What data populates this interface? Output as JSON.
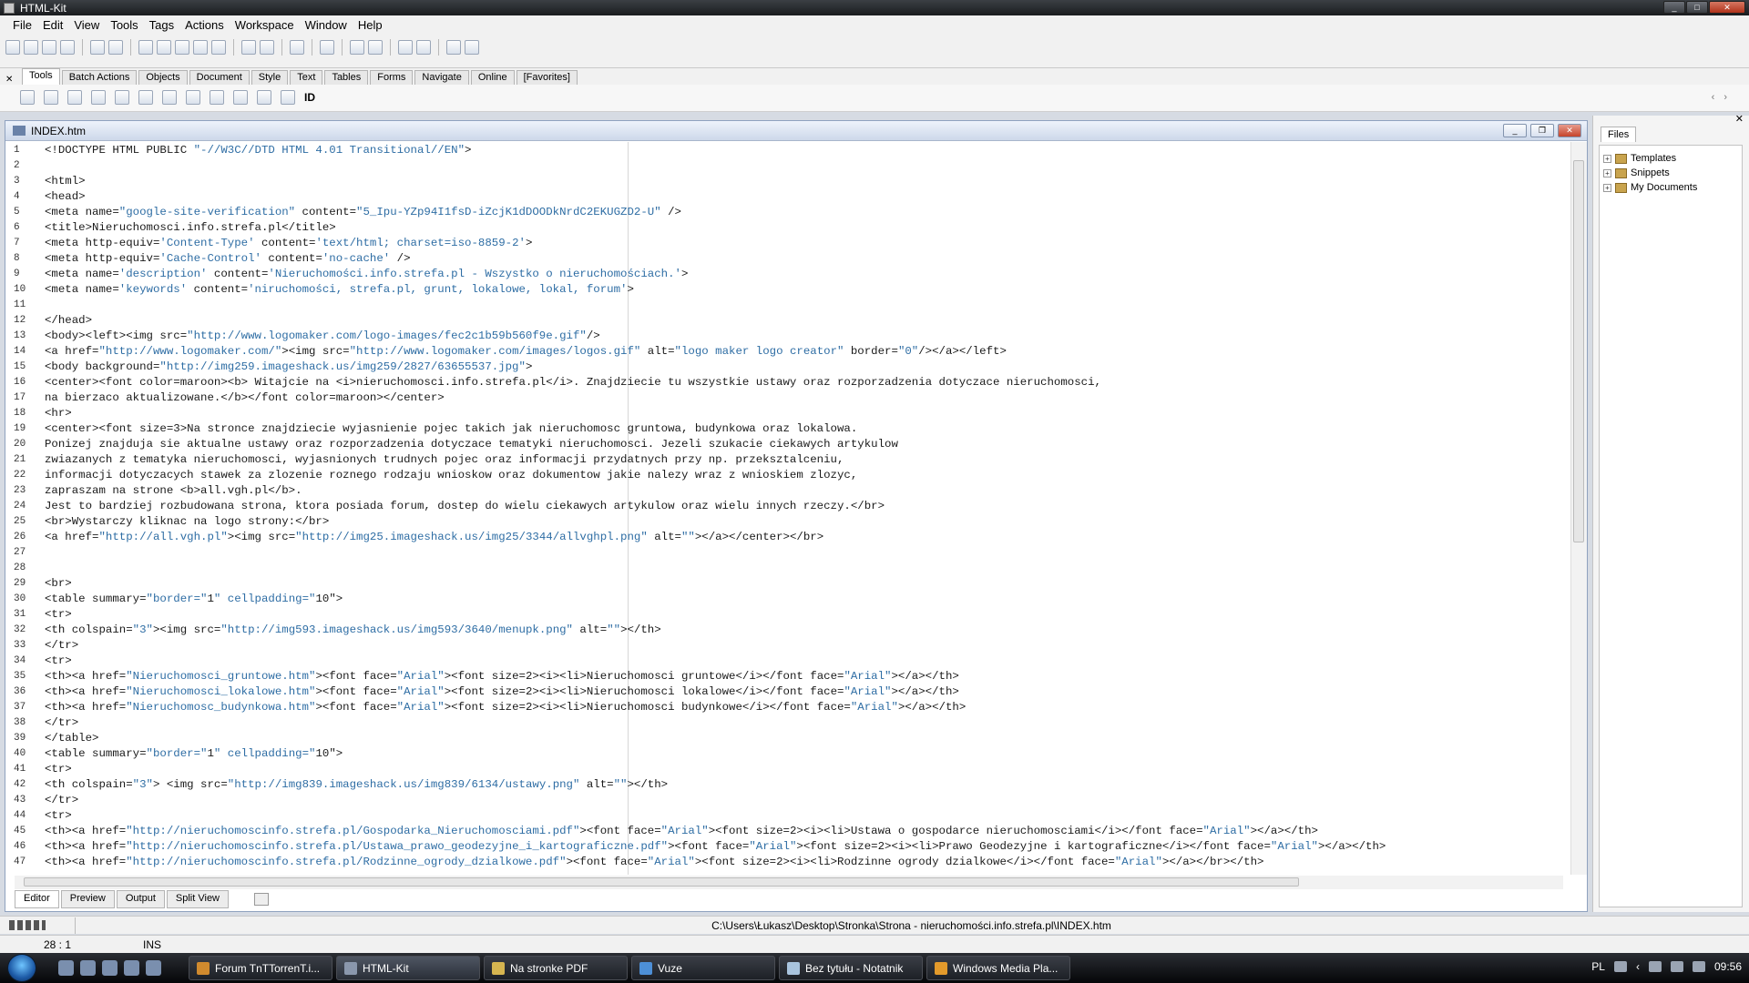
{
  "window": {
    "title": "HTML-Kit"
  },
  "menu": [
    "File",
    "Edit",
    "View",
    "Tools",
    "Tags",
    "Actions",
    "Workspace",
    "Window",
    "Help"
  ],
  "tabs": [
    "Tools",
    "Batch Actions",
    "Objects",
    "Document",
    "Style",
    "Text",
    "Tables",
    "Forms",
    "Navigate",
    "Online",
    "[Favorites]"
  ],
  "tools_row_label": "ID",
  "editor": {
    "title": "INDEX.htm",
    "lines": [
      "<!DOCTYPE HTML PUBLIC \"-//W3C//DTD HTML 4.01 Transitional//EN\">",
      "",
      "<html>",
      "<head>",
      "<meta name=\"google-site-verification\" content=\"5_Ipu-YZp94I1fsD-iZcjK1dDOODkNrdC2EKUGZD2-U\" />",
      "<title>Nieruchomosci.info.strefa.pl</title>",
      "<meta http-equiv='Content-Type' content='text/html; charset=iso-8859-2'>",
      "<meta http-equiv='Cache-Control' content='no-cache' />",
      "<meta name='description' content='Nieruchomości.info.strefa.pl - Wszystko o nieruchomościach.'>",
      "<meta name='keywords' content='niruchomości, strefa.pl, grunt, lokalowe, lokal, forum'>",
      "",
      "</head>",
      "<body><left><img src=\"http://www.logomaker.com/logo-images/fec2c1b59b560f9e.gif\"/>",
      "<a href=\"http://www.logomaker.com/\"><img src=\"http://www.logomaker.com/images/logos.gif\" alt=\"logo maker logo creator\" border=\"0\"/></a></left>",
      "<body background=\"http://img259.imageshack.us/img259/2827/63655537.jpg\">",
      "<center><font color=maroon><b> Witajcie na <i>nieruchomosci.info.strefa.pl</i>. Znajdziecie tu wszystkie ustawy oraz rozporzadzenia dotyczace nieruchomosci,",
      "na bierzaco aktualizowane.</b></font color=maroon></center>",
      "<hr>",
      "<center><font size=3>Na stronce znajdziecie wyjasnienie pojec takich jak nieruchomosc gruntowa, budynkowa oraz lokalowa.",
      "Ponizej znajduja sie aktualne ustawy oraz rozporzadzenia dotyczace tematyki nieruchomosci. Jezeli szukacie ciekawych artykulow",
      "zwiazanych z tematyka nieruchomosci, wyjasnionych trudnych pojec oraz informacji przydatnych przy np. przeksztalceniu,",
      "informacji dotyczacych stawek za zlozenie roznego rodzaju wnioskow oraz dokumentow jakie nalezy wraz z wnioskiem zlozyc,",
      "zapraszam na strone <b>all.vgh.pl</b>.",
      "Jest to bardziej rozbudowana strona, ktora posiada forum, dostep do wielu ciekawych artykulow oraz wielu innych rzeczy.</br>",
      "<br>Wystarczy kliknac na logo strony:</br>",
      "<a href=\"http://all.vgh.pl\"><img src=\"http://img25.imageshack.us/img25/3344/allvghpl.png\" alt=\"\"></a></center></br>",
      "",
      "",
      "<br>",
      "<table summary=\"border=\"1\" cellpadding=\"10\">",
      "<tr>",
      "<th colspain=\"3\"><img src=\"http://img593.imageshack.us/img593/3640/menupk.png\" alt=\"\"></th>",
      "</tr>",
      "<tr>",
      "<th><a href=\"Nieruchomosci_gruntowe.htm\"><font face=\"Arial\"><font size=2><i><li>Nieruchomosci gruntowe</i></font face=\"Arial\"></a></th>",
      "<th><a href=\"Nieruchomosci_lokalowe.htm\"><font face=\"Arial\"><font size=2><i><li>Nieruchomosci lokalowe</i></font face=\"Arial\"></a></th>",
      "<th><a href=\"Nieruchomosc_budynkowa.htm\"><font face=\"Arial\"><font size=2><i><li>Nieruchomosci budynkowe</i></font face=\"Arial\"></a></th>",
      "</tr>",
      "</table>",
      "<table summary=\"border=\"1\" cellpadding=\"10\">",
      "<tr>",
      "<th colspain=\"3\"> <img src=\"http://img839.imageshack.us/img839/6134/ustawy.png\" alt=\"\"></th>",
      "</tr>",
      "<tr>",
      "<th><a href=\"http://nieruchomoscinfo.strefa.pl/Gospodarka_Nieruchomosciami.pdf\"><font face=\"Arial\"><font size=2><i><li>Ustawa o gospodarce nieruchomosciami</i></font face=\"Arial\"></a></th>",
      "<th><a href=\"http://nieruchomoscinfo.strefa.pl/Ustawa_prawo_geodezyjne_i_kartograficzne.pdf\"><font face=\"Arial\"><font size=2><i><li>Prawo Geodezyjne i kartograficzne</i></font face=\"Arial\"></a></th>",
      "<th><a href=\"http://nieruchomoscinfo.strefa.pl/Rodzinne_ogrody_dzialkowe.pdf\"><font face=\"Arial\"><font size=2><i><li>Rodzinne ogrody dzialkowe</i></font face=\"Arial\"></a></br></th>"
    ],
    "bottom_tabs": [
      "Editor",
      "Preview",
      "Output",
      "Split View"
    ]
  },
  "files_panel": {
    "tab": "Files",
    "items": [
      "Templates",
      "Snippets",
      "My Documents"
    ]
  },
  "path": "C:\\Users\\Łukasz\\Desktop\\Stronka\\Strona - nieruchomości.info.strefa.pl\\INDEX.htm",
  "status": {
    "position": "28 : 1",
    "mode": "INS"
  },
  "taskbar": {
    "tasks": [
      "Forum TnTTorrenT.i...",
      "HTML-Kit",
      "Na stronke PDF",
      "Vuze",
      "Bez tytułu - Notatnik",
      "Windows Media Pla..."
    ],
    "lang": "PL",
    "clock": "09:56"
  },
  "colors": {
    "tag": "#1a1a1a",
    "attr_value": "#2e6da4",
    "accent": "#1d5aa6"
  }
}
